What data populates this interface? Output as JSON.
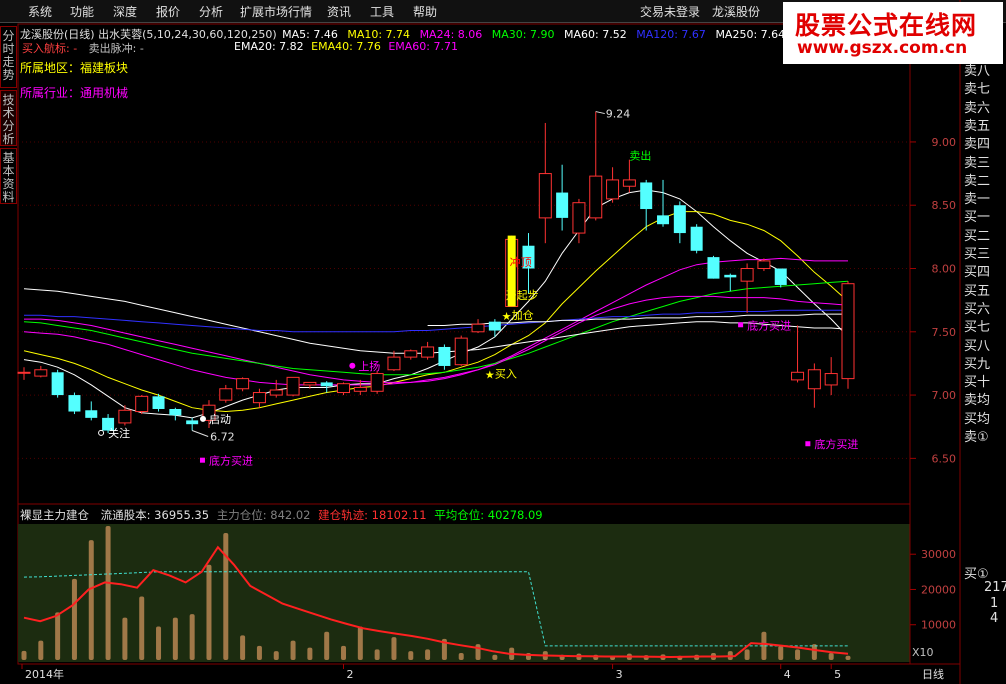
{
  "menu": {
    "items": [
      "系统",
      "功能",
      "深度",
      "报价",
      "分析",
      "扩展市场行情",
      "资讯",
      "工具",
      "帮助"
    ],
    "login_status": "交易未登录",
    "stock_short": "龙溪股份"
  },
  "side_tabs": [
    "分时走势",
    "技术分析",
    "基本资料"
  ],
  "watermark": {
    "title": "股票公式在线网",
    "url": "www.gszx.com.cn"
  },
  "price_panel": {
    "header": "龙溪股份(日线) 出水芙蓉(5,10,24,30,60,120,250)",
    "ma": [
      {
        "label": "MA5: 7.46",
        "color": "#ffffff"
      },
      {
        "label": "MA10: 7.74",
        "color": "#ffff00"
      },
      {
        "label": "MA24: 8.06",
        "color": "#ff00ff"
      },
      {
        "label": "MA30: 7.90",
        "color": "#00ff00"
      },
      {
        "label": "MA60: 7.52",
        "color": "#ffffff"
      },
      {
        "label": "MA120: 7.67",
        "color": "#3030ff"
      },
      {
        "label": "MA250: 7.64",
        "color": "#ffffff"
      }
    ],
    "buy_sell_line": {
      "buy": "买入航标: -",
      "sell": "卖出脉冲: -"
    },
    "ema": [
      {
        "label": "EMA20: 7.82",
        "color": "#ffffff"
      },
      {
        "label": "EMA40: 7.76",
        "color": "#ffff00"
      },
      {
        "label": "EMA60: 7.71",
        "color": "#ff00ff"
      }
    ],
    "region_label": "所属地区：",
    "region_value": "福建板块",
    "industry_label": "所属行业：",
    "industry_value": "通用机械",
    "high_label": "9.24",
    "low_label": "6.72"
  },
  "signals": [
    {
      "text": "关注",
      "color": "#ffffff"
    },
    {
      "text": "启动",
      "color": "#ffffff"
    },
    {
      "text": "底方买进",
      "color": "#ff00ff"
    },
    {
      "text": "上扬",
      "color": "#ff00ff"
    },
    {
      "text": "买入",
      "color": "#ffff00"
    },
    {
      "text": "加仓",
      "color": "#ffff00"
    },
    {
      "text": "开起步",
      "color": "#ffff00"
    },
    {
      "text": "冲顶",
      "color": "#ff0000"
    },
    {
      "text": "卖出",
      "color": "#00ff00"
    },
    {
      "text": "底方买进",
      "color": "#ff00ff"
    },
    {
      "text": "底方买进",
      "color": "#ff00ff"
    }
  ],
  "indicator_panel": {
    "name": "裸显主力建仓",
    "float_label": "流通股本: 36955.35",
    "main_label": "主力仓位: 842.02",
    "build_label": "建仓轨迹: 18102.11",
    "avg_label": "平均仓位: 40278.09",
    "multiplier": "X10"
  },
  "x_axis": {
    "labels": [
      "2014年",
      "2",
      "3",
      "4",
      "5"
    ],
    "period": "日线"
  },
  "order_book": {
    "sell": [
      "卖八",
      "卖七",
      "卖六",
      "卖五",
      "卖四",
      "卖三",
      "卖二",
      "卖一"
    ],
    "buy": [
      "买一",
      "买二",
      "买三",
      "买四",
      "买五",
      "买六",
      "买七",
      "买八",
      "买九",
      "买十"
    ],
    "avg": [
      "卖均",
      "买均"
    ],
    "extra": [
      "卖①",
      "买①"
    ],
    "numbers": [
      "217",
      "1",
      "4"
    ]
  },
  "chart_data": {
    "type": "candlestick",
    "ylim": [
      6.25,
      9.6
    ],
    "y_ticks": [
      "9.00",
      "8.50",
      "8.00",
      "7.50",
      "7.00",
      "6.50"
    ],
    "y_tick_values": [
      9.0,
      8.5,
      8.0,
      7.5,
      7.0,
      6.5
    ],
    "candles": [
      {
        "o": 7.18,
        "c": 7.18,
        "h": 7.22,
        "l": 7.12
      },
      {
        "o": 7.15,
        "c": 7.2,
        "h": 7.23,
        "l": 7.14
      },
      {
        "o": 7.18,
        "c": 7.0,
        "h": 7.2,
        "l": 6.98
      },
      {
        "o": 7.0,
        "c": 6.87,
        "h": 7.02,
        "l": 6.85
      },
      {
        "o": 6.88,
        "c": 6.82,
        "h": 6.95,
        "l": 6.8
      },
      {
        "o": 6.82,
        "c": 6.72,
        "h": 6.85,
        "l": 6.7
      },
      {
        "o": 6.78,
        "c": 6.88,
        "h": 6.92,
        "l": 6.76
      },
      {
        "o": 6.87,
        "c": 6.99,
        "h": 7.0,
        "l": 6.85
      },
      {
        "o": 6.99,
        "c": 6.89,
        "h": 7.01,
        "l": 6.87
      },
      {
        "o": 6.89,
        "c": 6.84,
        "h": 6.9,
        "l": 6.8
      },
      {
        "o": 6.8,
        "c": 6.77,
        "h": 6.82,
        "l": 6.72
      },
      {
        "o": 6.8,
        "c": 6.92,
        "h": 6.96,
        "l": 6.74
      },
      {
        "o": 6.96,
        "c": 7.05,
        "h": 7.08,
        "l": 6.94
      },
      {
        "o": 7.05,
        "c": 7.13,
        "h": 7.14,
        "l": 7.03
      },
      {
        "o": 6.94,
        "c": 7.02,
        "h": 7.05,
        "l": 6.9
      },
      {
        "o": 7.0,
        "c": 7.04,
        "h": 7.12,
        "l": 6.98
      },
      {
        "o": 7.0,
        "c": 7.14,
        "h": 7.14,
        "l": 6.99
      },
      {
        "o": 7.08,
        "c": 7.1,
        "h": 7.1,
        "l": 7.05
      },
      {
        "o": 7.1,
        "c": 7.07,
        "h": 7.11,
        "l": 7.02
      },
      {
        "o": 7.02,
        "c": 7.09,
        "h": 7.1,
        "l": 7.0
      },
      {
        "o": 7.03,
        "c": 7.06,
        "h": 7.12,
        "l": 7.0
      },
      {
        "o": 7.03,
        "c": 7.17,
        "h": 7.19,
        "l": 7.01
      },
      {
        "o": 7.2,
        "c": 7.3,
        "h": 7.35,
        "l": 7.19
      },
      {
        "o": 7.3,
        "c": 7.35,
        "h": 7.36,
        "l": 7.28
      },
      {
        "o": 7.3,
        "c": 7.38,
        "h": 7.42,
        "l": 7.28
      },
      {
        "o": 7.38,
        "c": 7.23,
        "h": 7.4,
        "l": 7.2
      },
      {
        "o": 7.24,
        "c": 7.45,
        "h": 7.47,
        "l": 7.23
      },
      {
        "o": 7.5,
        "c": 7.56,
        "h": 7.6,
        "l": 7.49
      },
      {
        "o": 7.58,
        "c": 7.51,
        "h": 7.6,
        "l": 7.46
      },
      {
        "o": 7.7,
        "c": 8.23,
        "h": 8.26,
        "l": 7.7
      },
      {
        "o": 8.18,
        "c": 8.0,
        "h": 8.28,
        "l": 7.8
      },
      {
        "o": 8.4,
        "c": 8.75,
        "h": 9.15,
        "l": 8.2
      },
      {
        "o": 8.6,
        "c": 8.4,
        "h": 8.82,
        "l": 8.3
      },
      {
        "o": 8.28,
        "c": 8.52,
        "h": 8.55,
        "l": 8.2
      },
      {
        "o": 8.4,
        "c": 8.73,
        "h": 9.24,
        "l": 8.38
      },
      {
        "o": 8.55,
        "c": 8.7,
        "h": 8.8,
        "l": 8.52
      },
      {
        "o": 8.65,
        "c": 8.7,
        "h": 8.86,
        "l": 8.6
      },
      {
        "o": 8.68,
        "c": 8.47,
        "h": 8.7,
        "l": 8.3
      },
      {
        "o": 8.42,
        "c": 8.35,
        "h": 8.7,
        "l": 8.33
      },
      {
        "o": 8.5,
        "c": 8.28,
        "h": 8.53,
        "l": 8.2
      },
      {
        "o": 8.33,
        "c": 8.14,
        "h": 8.35,
        "l": 8.12
      },
      {
        "o": 8.09,
        "c": 7.92,
        "h": 8.1,
        "l": 7.92
      },
      {
        "o": 7.95,
        "c": 7.93,
        "h": 7.96,
        "l": 7.82
      },
      {
        "o": 7.9,
        "c": 8.0,
        "h": 8.04,
        "l": 7.65
      },
      {
        "o": 8.0,
        "c": 8.06,
        "h": 8.08,
        "l": 7.98
      },
      {
        "o": 8.0,
        "c": 7.87,
        "h": 8.0,
        "l": 7.85
      },
      {
        "o": 7.12,
        "c": 7.18,
        "h": 7.55,
        "l": 7.1
      },
      {
        "o": 7.05,
        "c": 7.2,
        "h": 7.25,
        "l": 6.9
      },
      {
        "o": 7.08,
        "c": 7.17,
        "h": 7.3,
        "l": 7.0
      },
      {
        "o": 7.13,
        "c": 7.88,
        "h": 7.9,
        "l": 7.05
      }
    ],
    "ma_lines": [
      {
        "name": "MA5",
        "color": "#ffffff",
        "values": [
          7.28,
          7.26,
          7.22,
          7.16,
          7.08,
          6.99,
          6.9,
          6.86,
          6.85,
          6.84,
          6.82,
          6.86,
          6.91,
          6.96,
          7.0,
          7.04,
          7.06,
          7.06,
          7.06,
          7.08,
          7.09,
          7.09,
          7.13,
          7.16,
          7.21,
          7.27,
          7.33,
          7.38,
          7.46,
          7.6,
          7.74,
          7.9,
          8.12,
          8.3,
          8.48,
          8.55,
          8.6,
          8.62,
          8.6,
          8.55,
          8.45,
          8.33,
          8.22,
          8.12,
          8.05,
          7.98,
          7.85,
          7.72,
          7.6,
          7.46
        ]
      },
      {
        "name": "MA10",
        "color": "#ffff00",
        "values": [
          7.35,
          7.32,
          7.29,
          7.25,
          7.2,
          7.14,
          7.09,
          7.04,
          7.0,
          6.95,
          6.9,
          6.88,
          6.87,
          6.88,
          6.9,
          6.93,
          6.96,
          6.99,
          7.02,
          7.04,
          7.06,
          7.07,
          7.1,
          7.13,
          7.16,
          7.18,
          7.22,
          7.26,
          7.32,
          7.4,
          7.47,
          7.57,
          7.72,
          7.85,
          7.98,
          8.1,
          8.22,
          8.33,
          8.4,
          8.45,
          8.45,
          8.43,
          8.38,
          8.35,
          8.3,
          8.22,
          8.1,
          7.97,
          7.86,
          7.74
        ]
      },
      {
        "name": "MA24",
        "color": "#ff00ff",
        "values": [
          7.6,
          7.6,
          7.59,
          7.57,
          7.55,
          7.52,
          7.49,
          7.46,
          7.43,
          7.4,
          7.37,
          7.34,
          7.31,
          7.28,
          7.25,
          7.22,
          7.19,
          7.16,
          7.14,
          7.12,
          7.11,
          7.1,
          7.1,
          7.1,
          7.11,
          7.13,
          7.16,
          7.2,
          7.25,
          7.31,
          7.38,
          7.45,
          7.52,
          7.59,
          7.66,
          7.73,
          7.8,
          7.87,
          7.93,
          7.99,
          8.03,
          8.05,
          8.06,
          8.07,
          8.07,
          8.08,
          8.07,
          8.06,
          8.06,
          8.06
        ]
      },
      {
        "name": "MA30",
        "color": "#00ff00",
        "values": [
          7.58,
          7.57,
          7.55,
          7.53,
          7.51,
          7.48,
          7.45,
          7.42,
          7.39,
          7.36,
          7.33,
          7.31,
          7.29,
          7.27,
          7.25,
          7.23,
          7.21,
          7.2,
          7.19,
          7.18,
          7.17,
          7.16,
          7.16,
          7.16,
          7.17,
          7.18,
          7.2,
          7.22,
          7.25,
          7.29,
          7.33,
          7.38,
          7.43,
          7.48,
          7.53,
          7.58,
          7.62,
          7.66,
          7.7,
          7.74,
          7.77,
          7.8,
          7.82,
          7.84,
          7.85,
          7.86,
          7.87,
          7.88,
          7.89,
          7.9
        ]
      },
      {
        "name": "MA60",
        "color": "#ffffff",
        "values": [
          7.84,
          7.83,
          7.82,
          7.8,
          7.78,
          7.76,
          7.74,
          7.71,
          7.68,
          7.65,
          7.62,
          7.59,
          7.56,
          7.53,
          7.5,
          7.47,
          7.44,
          7.41,
          7.39,
          7.37,
          7.35,
          7.34,
          7.33,
          7.33,
          7.33,
          7.34,
          7.35,
          7.36,
          7.38,
          7.4,
          7.42,
          7.44,
          7.46,
          7.48,
          7.5,
          7.52,
          7.54,
          7.55,
          7.56,
          7.57,
          7.58,
          7.58,
          7.57,
          7.57,
          7.56,
          7.55,
          7.54,
          7.53,
          7.53,
          7.52
        ]
      },
      {
        "name": "MA120",
        "color": "#3030ff",
        "values": [
          7.63,
          7.63,
          7.62,
          7.62,
          7.61,
          7.6,
          7.59,
          7.58,
          7.57,
          7.56,
          7.55,
          7.54,
          7.53,
          7.52,
          7.51,
          7.51,
          7.5,
          7.5,
          7.5,
          7.5,
          7.5,
          7.5,
          7.5,
          7.51,
          7.51,
          7.52,
          7.53,
          7.54,
          7.55,
          7.56,
          7.57,
          7.58,
          7.59,
          7.6,
          7.61,
          7.62,
          7.62,
          7.63,
          7.64,
          7.64,
          7.65,
          7.65,
          7.66,
          7.66,
          7.66,
          7.67,
          7.67,
          7.67,
          7.67,
          7.67
        ]
      },
      {
        "name": "MA250",
        "color": "#ffffff",
        "values": [
          null,
          null,
          null,
          null,
          null,
          null,
          null,
          null,
          null,
          null,
          null,
          null,
          null,
          null,
          null,
          null,
          null,
          null,
          null,
          null,
          null,
          null,
          null,
          null,
          7.55,
          7.55,
          7.56,
          7.56,
          7.57,
          7.57,
          7.58,
          7.58,
          7.59,
          7.59,
          7.6,
          7.6,
          7.6,
          7.61,
          7.61,
          7.61,
          7.62,
          7.62,
          7.62,
          7.63,
          7.63,
          7.63,
          7.63,
          7.64,
          7.64,
          7.64
        ]
      },
      {
        "name": "EMA40",
        "color": "#ff00ff",
        "values": [
          7.5,
          7.49,
          7.48,
          7.46,
          7.43,
          7.4,
          7.36,
          7.32,
          7.28,
          7.24,
          7.2,
          7.17,
          7.14,
          7.12,
          7.1,
          7.09,
          7.08,
          7.08,
          7.08,
          7.08,
          7.08,
          7.08,
          7.09,
          7.1,
          7.12,
          7.14,
          7.17,
          7.2,
          7.24,
          7.3,
          7.36,
          7.43,
          7.5,
          7.57,
          7.63,
          7.68,
          7.72,
          7.75,
          7.77,
          7.78,
          7.78,
          7.78,
          7.77,
          7.77,
          7.77,
          7.76,
          7.74,
          7.73,
          7.72,
          7.71
        ]
      }
    ],
    "indicator": {
      "ylim": [
        0,
        38000
      ],
      "y_ticks": [
        "30000",
        "20000",
        "10000"
      ],
      "y_tick_values": [
        30000,
        20000,
        10000
      ],
      "bars": [
        2600,
        5500,
        13500,
        23000,
        34000,
        38000,
        12000,
        18000,
        9500,
        12000,
        13000,
        27000,
        36000,
        7000,
        4000,
        2500,
        5500,
        3500,
        8000,
        4000,
        9500,
        3000,
        6500,
        2500,
        3000,
        6000,
        2000,
        4500,
        1500,
        3500,
        2000,
        2500,
        1500,
        1800,
        1500,
        1200,
        1800,
        1400,
        1600,
        1200,
        1500,
        2000,
        2500,
        3000,
        8000,
        4000,
        3000,
        4500,
        2000,
        1200
      ],
      "main_line": [
        12000,
        11000,
        12500,
        15500,
        20000,
        22000,
        21500,
        20500,
        25500,
        24000,
        22000,
        25000,
        32000,
        27000,
        21000,
        18500,
        16000,
        14500,
        13000,
        11500,
        10200,
        9000,
        8200,
        7500,
        6800,
        6000,
        5000,
        4200,
        3500,
        2500,
        1800,
        1500,
        1300,
        1200,
        1100,
        1050,
        1000,
        980,
        950,
        900,
        850,
        900,
        1000,
        1000,
        1100,
        4800,
        4500,
        4000,
        3500,
        2800,
        2200,
        1800
      ],
      "avg_line": [
        23500,
        23600,
        23800,
        24000,
        24200,
        24400,
        24600,
        24800,
        25000,
        25000,
        25000,
        25000,
        25000,
        25000,
        25000,
        25000,
        25000,
        25000,
        25000,
        25000,
        25000,
        25000,
        25000,
        25000,
        25000,
        25000,
        25000,
        25000,
        25000,
        25000,
        25000,
        4000,
        4000,
        4000,
        4000,
        4000,
        4000,
        4000,
        4000,
        4000,
        4000,
        4000,
        4000,
        4000,
        4000,
        4000,
        4000,
        4000,
        4000,
        4000
      ]
    }
  }
}
